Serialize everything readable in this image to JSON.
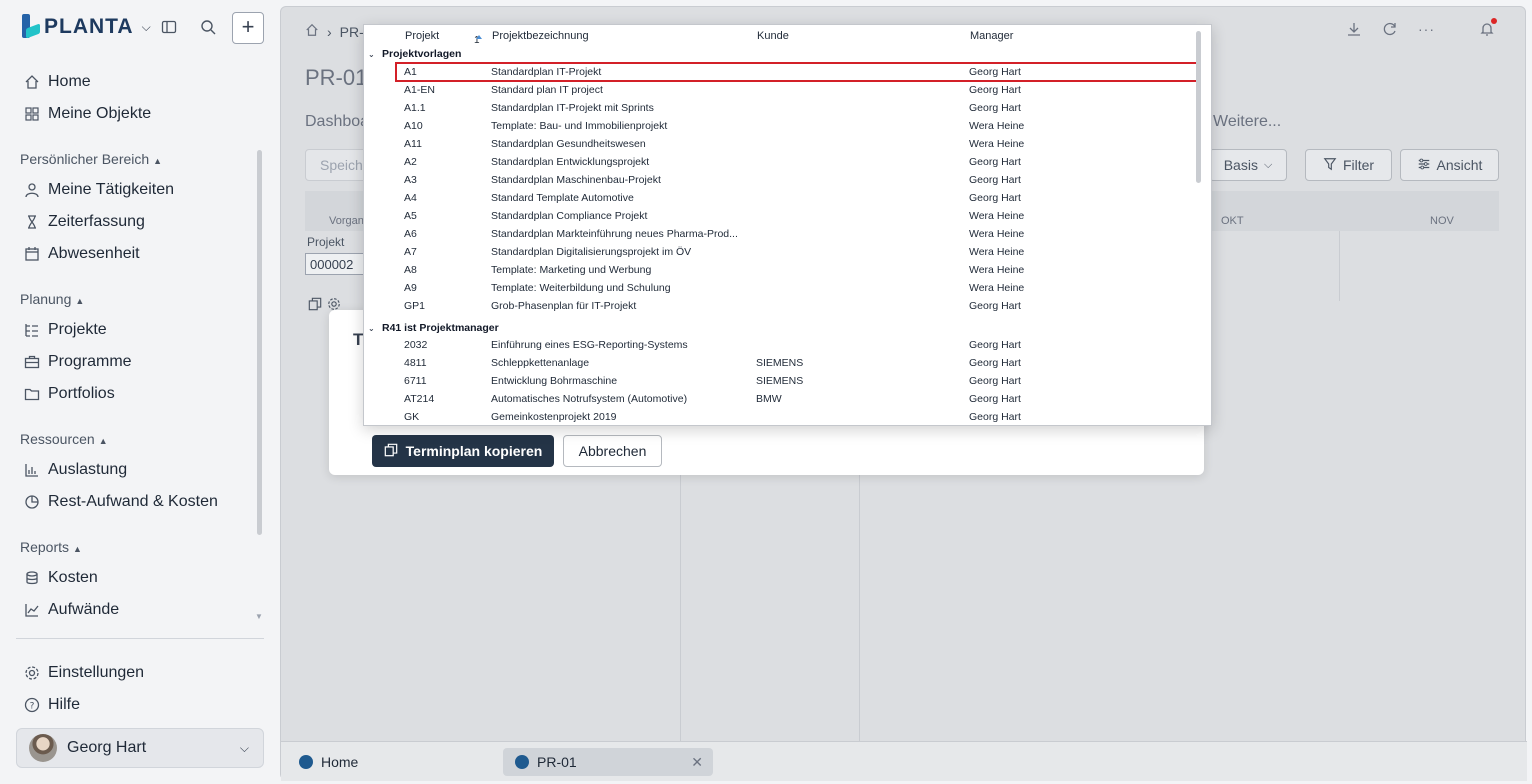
{
  "sidebar": {
    "logo_text": "PLANTA",
    "nav_top": [
      {
        "label": "Home",
        "icon": "home-icon"
      },
      {
        "label": "Meine Objekte",
        "icon": "grid-icon"
      }
    ],
    "sections": [
      {
        "title": "Persönlicher Bereich",
        "items": [
          "Meine Tätigkeiten",
          "Zeiterfassung",
          "Abwesenheit"
        ]
      },
      {
        "title": "Planung",
        "items": [
          "Projekte",
          "Programme",
          "Portfolios"
        ]
      },
      {
        "title": "Ressourcen",
        "items": [
          "Auslastung",
          "Rest-Aufwand & Kosten"
        ]
      },
      {
        "title": "Reports",
        "items": [
          "Kosten",
          "Aufwände"
        ]
      }
    ],
    "bottom": [
      "Einstellungen",
      "Hilfe"
    ],
    "user": "Georg Hart"
  },
  "main": {
    "breadcrumb_item": "PR-",
    "title": "PR-01",
    "tab_first": "Dashboa",
    "tab_more": "Weitere...",
    "save_input": "Speich",
    "btn_basis": "Basis",
    "btn_filter": "Filter",
    "btn_view": "Ansicht",
    "gantt_col_vorgang": "Vorgan",
    "gantt_months": [
      "OKT",
      "NOV"
    ],
    "project_label": "Projekt",
    "project_value": "000002"
  },
  "bottom_tabs": [
    {
      "label": "Home"
    },
    {
      "label": "PR-01"
    }
  ],
  "dialog": {
    "title_initial": "T",
    "primary_button": "Terminplan kopieren",
    "secondary_button": "Abbrechen"
  },
  "dropdown": {
    "columns": {
      "projekt": "Projekt",
      "sort": "1",
      "bezeichnung": "Projektbezeichnung",
      "kunde": "Kunde",
      "manager": "Manager"
    },
    "groups": [
      {
        "title": "Projektvorlagen",
        "rows": [
          {
            "projekt": "A1",
            "bezeichnung": "Standardplan IT-Projekt",
            "kunde": "",
            "manager": "Georg Hart",
            "selected": true
          },
          {
            "projekt": "A1-EN",
            "bezeichnung": "Standard plan IT project",
            "kunde": "",
            "manager": "Georg Hart"
          },
          {
            "projekt": "A1.1",
            "bezeichnung": "Standardplan IT-Projekt mit Sprints",
            "kunde": "",
            "manager": "Georg Hart"
          },
          {
            "projekt": "A10",
            "bezeichnung": "Template: Bau- und Immobilienprojekt",
            "kunde": "",
            "manager": "Wera Heine"
          },
          {
            "projekt": "A11",
            "bezeichnung": "Standardplan Gesundheitswesen",
            "kunde": "",
            "manager": "Wera Heine"
          },
          {
            "projekt": "A2",
            "bezeichnung": "Standardplan Entwicklungsprojekt",
            "kunde": "",
            "manager": "Georg Hart"
          },
          {
            "projekt": "A3",
            "bezeichnung": "Standardplan Maschinenbau-Projekt",
            "kunde": "",
            "manager": "Georg Hart"
          },
          {
            "projekt": "A4",
            "bezeichnung": "Standard Template Automotive",
            "kunde": "",
            "manager": "Georg Hart"
          },
          {
            "projekt": "A5",
            "bezeichnung": "Standardplan Compliance Projekt",
            "kunde": "",
            "manager": "Wera Heine"
          },
          {
            "projekt": "A6",
            "bezeichnung": "Standardplan Markteinführung neues Pharma-Prod...",
            "kunde": "",
            "manager": "Wera Heine"
          },
          {
            "projekt": "A7",
            "bezeichnung": "Standardplan Digitalisierungsprojekt im ÖV",
            "kunde": "",
            "manager": "Wera Heine"
          },
          {
            "projekt": "A8",
            "bezeichnung": "Template: Marketing und Werbung",
            "kunde": "",
            "manager": "Wera Heine"
          },
          {
            "projekt": "A9",
            "bezeichnung": "Template: Weiterbildung und Schulung",
            "kunde": "",
            "manager": "Wera Heine"
          },
          {
            "projekt": "GP1",
            "bezeichnung": "Grob-Phasenplan für IT-Projekt",
            "kunde": "",
            "manager": "Georg Hart"
          }
        ]
      },
      {
        "title": "R41 ist Projektmanager",
        "rows": [
          {
            "projekt": "2032",
            "bezeichnung": "Einführung eines ESG-Reporting-Systems",
            "kunde": "",
            "manager": "Georg Hart"
          },
          {
            "projekt": "4811",
            "bezeichnung": "Schleppkettenanlage",
            "kunde": "SIEMENS",
            "manager": "Georg Hart"
          },
          {
            "projekt": "6711",
            "bezeichnung": "Entwicklung Bohrmaschine",
            "kunde": "SIEMENS",
            "manager": "Georg Hart"
          },
          {
            "projekt": "AT214",
            "bezeichnung": "Automatisches Notrufsystem (Automotive)",
            "kunde": "BMW",
            "manager": "Georg Hart"
          },
          {
            "projekt": "GK",
            "bezeichnung": "Gemeinkostenprojekt 2019",
            "kunde": "",
            "manager": "Georg Hart"
          }
        ]
      }
    ]
  }
}
